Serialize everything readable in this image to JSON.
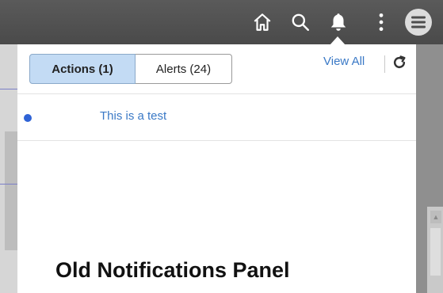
{
  "banner": {
    "home_icon": "home-icon",
    "search_icon": "search-icon",
    "bell_icon": "bell-icon",
    "more_icon": "vertical-dots-icon",
    "menu_icon": "hamburger-menu-icon"
  },
  "panel": {
    "tabs": [
      {
        "label": "Actions (1)",
        "active": true
      },
      {
        "label": "Alerts (24)",
        "active": false
      }
    ],
    "view_all": "View All",
    "refresh_icon": "refresh-icon",
    "notifications": [
      {
        "text": "This is a test",
        "unread": true
      }
    ]
  },
  "caption": "Old Notifications Panel",
  "colors": {
    "banner": "#4f4f4f",
    "active_tab": "#c3dbf4",
    "link": "#3a79c6",
    "unread_dot": "#2f63d6"
  }
}
